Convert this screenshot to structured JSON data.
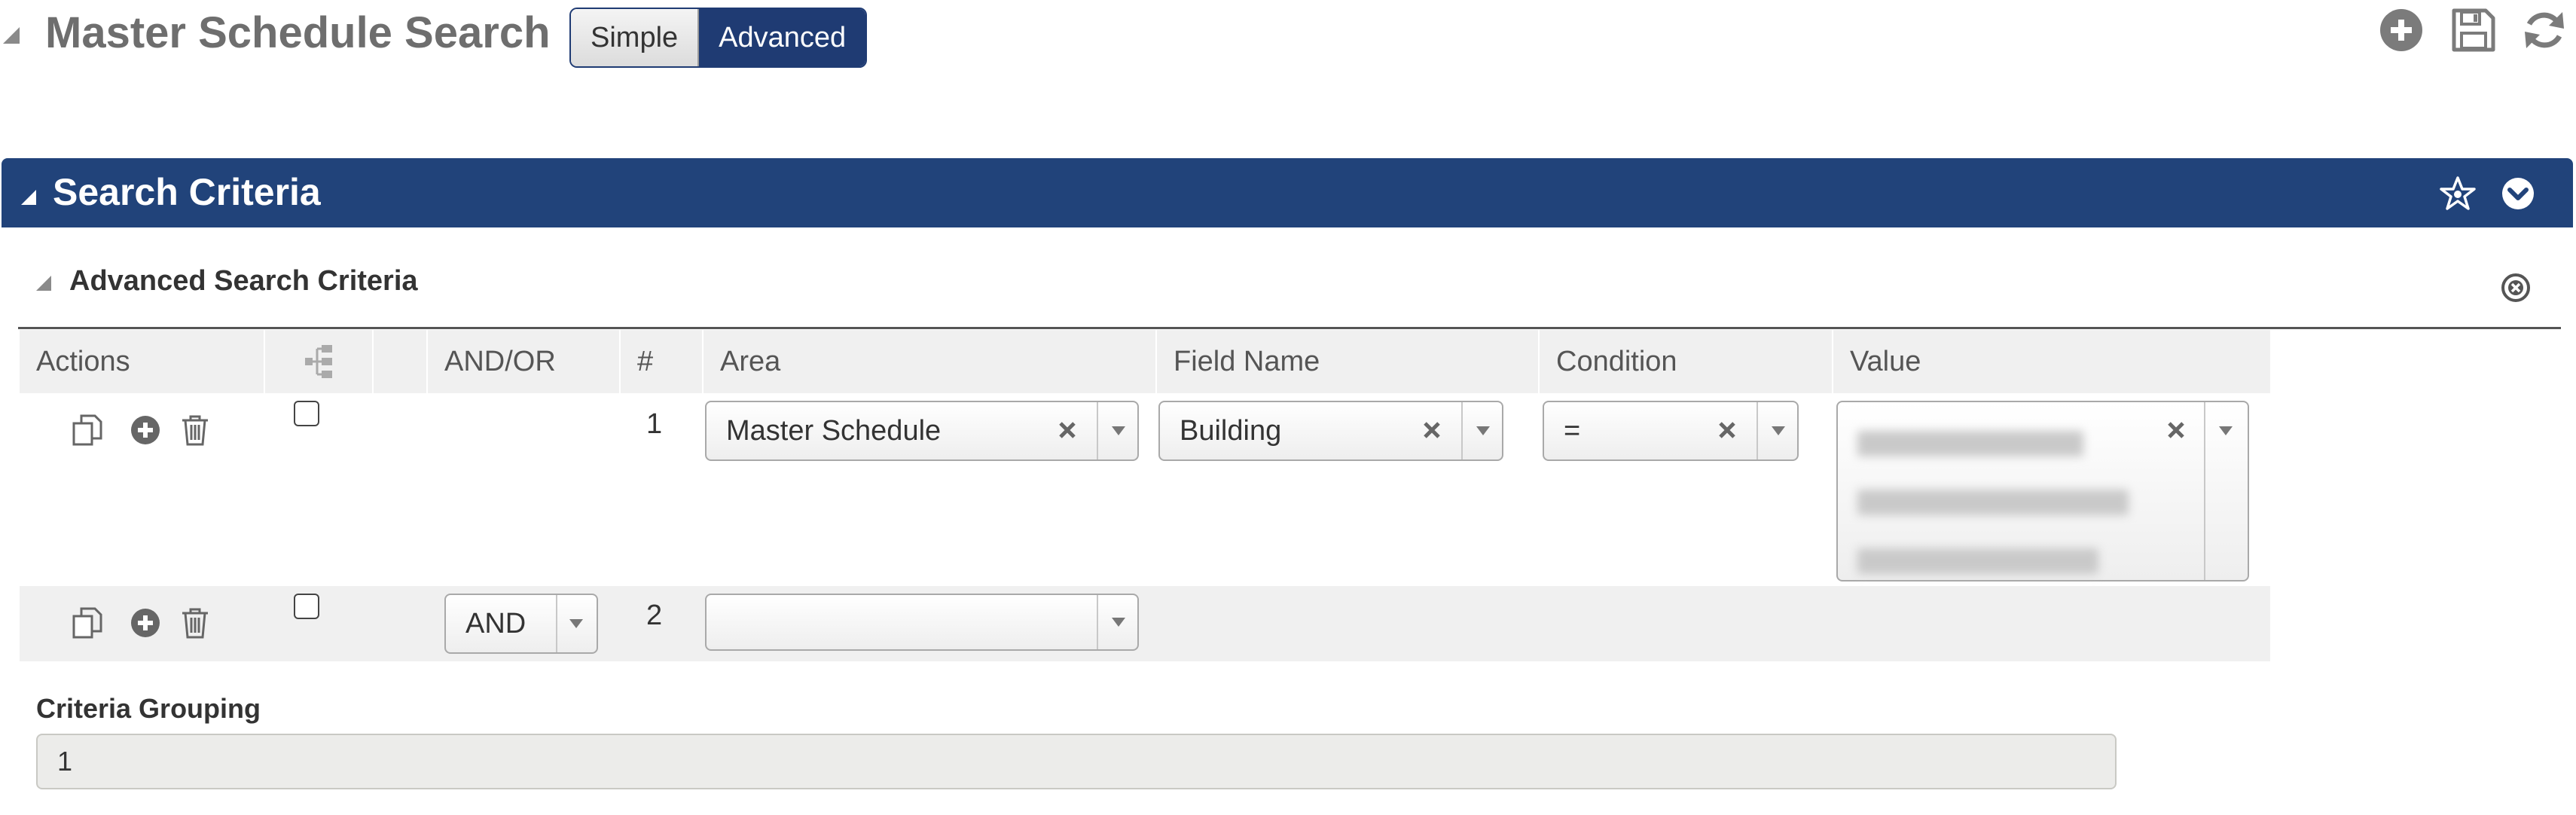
{
  "page": {
    "title": "Master Schedule Search",
    "mode_toggle": {
      "simple_label": "Simple",
      "advanced_label": "Advanced",
      "selected": "Advanced"
    },
    "toolbar_icons": [
      "add-icon",
      "save-icon",
      "refresh-icon"
    ]
  },
  "panel": {
    "title": "Search Criteria",
    "header_icons": [
      "favorite-star-icon",
      "chevron-down-icon"
    ],
    "accent_color": "#21437a"
  },
  "advanced": {
    "title": "Advanced Search Criteria",
    "columns": [
      "Actions",
      "",
      "",
      "AND/OR",
      "#",
      "Area",
      "Field Name",
      "Condition",
      "Value"
    ],
    "rows": [
      {
        "number": "1",
        "and_or": "",
        "area": "Master Schedule",
        "field_name": "Building",
        "condition": "=",
        "value": "",
        "checked": false
      },
      {
        "number": "2",
        "and_or": "AND",
        "area": "",
        "checked": false
      }
    ]
  },
  "criteria_grouping": {
    "label": "Criteria Grouping",
    "value": "1"
  }
}
